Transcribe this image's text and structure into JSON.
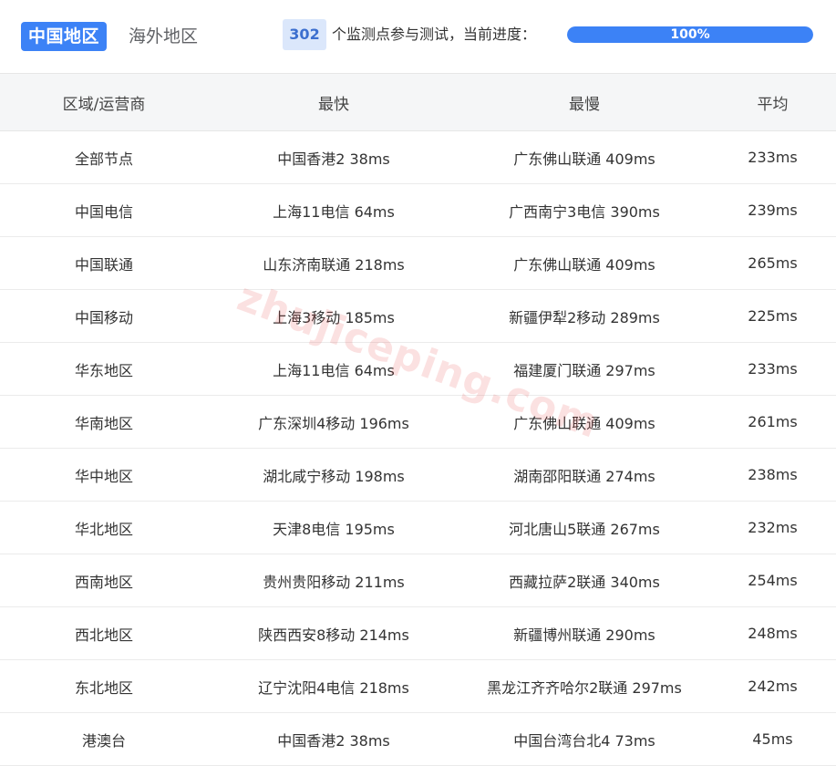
{
  "header": {
    "active_tab": "中国地区",
    "inactive_tab": "海外地区",
    "monitor_count": "302",
    "monitor_text": "个监测点参与测试，当前进度：",
    "progress_label": "100%",
    "progress_fraction": 1.0,
    "accent_color": "#3c82f6"
  },
  "table": {
    "headers": [
      "区域/运营商",
      "最快",
      "最慢",
      "平均"
    ],
    "rows": [
      [
        "全部节点",
        "中国香港2 38ms",
        "广东佛山联通 409ms",
        "233ms"
      ],
      [
        "中国电信",
        "上海11电信 64ms",
        "广西南宁3电信 390ms",
        "239ms"
      ],
      [
        "中国联通",
        "山东济南联通 218ms",
        "广东佛山联通 409ms",
        "265ms"
      ],
      [
        "中国移动",
        "上海3移动 185ms",
        "新疆伊犁2移动 289ms",
        "225ms"
      ],
      [
        "华东地区",
        "上海11电信 64ms",
        "福建厦门联通 297ms",
        "233ms"
      ],
      [
        "华南地区",
        "广东深圳4移动 196ms",
        "广东佛山联通 409ms",
        "261ms"
      ],
      [
        "华中地区",
        "湖北咸宁移动 198ms",
        "湖南邵阳联通 274ms",
        "238ms"
      ],
      [
        "华北地区",
        "天津8电信 195ms",
        "河北唐山5联通 267ms",
        "232ms"
      ],
      [
        "西南地区",
        "贵州贵阳移动 211ms",
        "西藏拉萨2联通 340ms",
        "254ms"
      ],
      [
        "西北地区",
        "陕西西安8移动 214ms",
        "新疆博州联通 290ms",
        "248ms"
      ],
      [
        "东北地区",
        "辽宁沈阳4电信 218ms",
        "黑龙江齐齐哈尔2联通 297ms",
        "242ms"
      ],
      [
        "港澳台",
        "中国香港2 38ms",
        "中国台湾台北4 73ms",
        "45ms"
      ]
    ]
  },
  "watermark": "zhujiceping.com"
}
